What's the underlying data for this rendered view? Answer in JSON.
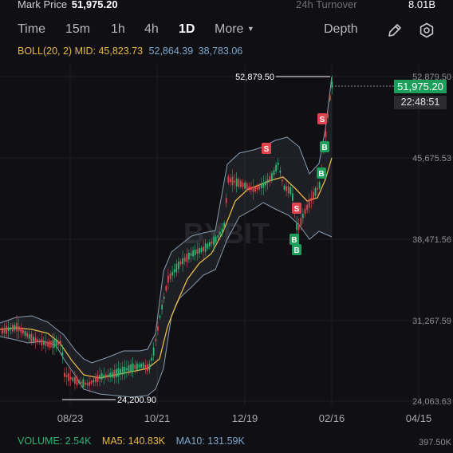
{
  "header": {
    "mark_price_label": "Mark Price",
    "mark_price_value": "51,975.20",
    "turnover_label": "24h Turnover",
    "turnover_value": "8.01B"
  },
  "intervals": [
    {
      "label": "Time",
      "active": false
    },
    {
      "label": "15m",
      "active": false
    },
    {
      "label": "1h",
      "active": false
    },
    {
      "label": "4h",
      "active": false
    },
    {
      "label": "1D",
      "active": true
    },
    {
      "label": "More",
      "active": false
    }
  ],
  "more_chevron_icon": "chevron-down-icon",
  "depth_label": "Depth",
  "tool_icons": [
    "pencil-icon",
    "settings-icon"
  ],
  "indicator": {
    "label": "BOLL(20, 2)",
    "mid_label": "MID:",
    "mid": "45,823.73",
    "upper": "52,864.39",
    "lower": "38,783.06"
  },
  "price_axis": [
    "52,879.50",
    "45,675.53",
    "38,471.56",
    "31,267.59",
    "24,063.63"
  ],
  "date_axis": [
    "08/23",
    "10/21",
    "12/19",
    "02/16",
    "04/15"
  ],
  "annotations": {
    "high": "52,879.50",
    "low": "24,200.90",
    "last_price": "51,975.20",
    "countdown": "22:48:51",
    "watermark": "BYBIT"
  },
  "signals": {
    "sell_label": "S",
    "buy_label": "B"
  },
  "volume": {
    "label": "VOLUME:",
    "value": "2.54K",
    "ma5_label": "MA5:",
    "ma5": "140.83K",
    "ma10_label": "MA10:",
    "ma10": "131.59K",
    "max": "397.50K"
  },
  "colors": {
    "up": "#2fb574",
    "down": "#e0454f",
    "mid_line": "#e6b84a",
    "band": "#8a9bb0",
    "accent_green": "#1d9e5a",
    "background": "#101014"
  }
}
